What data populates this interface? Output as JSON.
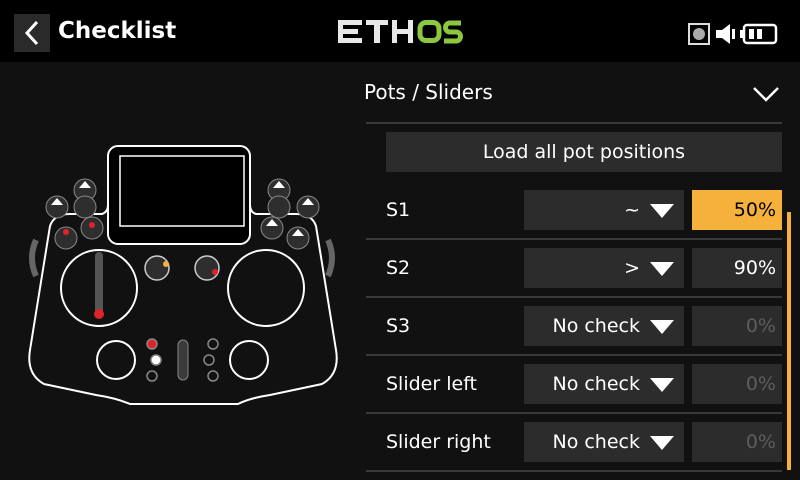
{
  "header": {
    "title": "Checklist",
    "logo": "ETHOS",
    "back_icon": "chevron-left-icon"
  },
  "status_icons": [
    "record-icon",
    "speaker-icon",
    "battery-icon"
  ],
  "section": {
    "title": "Pots / Sliders"
  },
  "load_button": {
    "label": "Load all pot positions"
  },
  "rows": [
    {
      "label": "S1",
      "check": "~",
      "value": "50%",
      "state": "active"
    },
    {
      "label": "S2",
      "check": ">",
      "value": "90%",
      "state": "normal"
    },
    {
      "label": "S3",
      "check": "No check",
      "value": "0%",
      "state": "dim"
    },
    {
      "label": "Slider left",
      "check": "No check",
      "value": "0%",
      "state": "dim"
    },
    {
      "label": "Slider right",
      "check": "No check",
      "value": "0%",
      "state": "dim"
    }
  ],
  "colors": {
    "accent": "#f6b13d",
    "logo_green": "#8dc63f"
  }
}
